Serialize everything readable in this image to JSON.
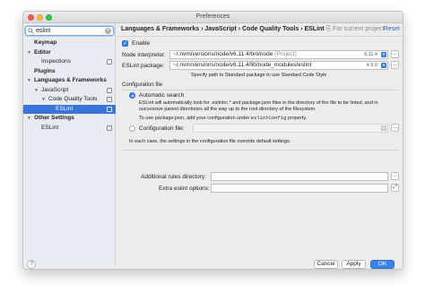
{
  "window": {
    "title": "Preferences"
  },
  "sidebar": {
    "search_value": "eslint",
    "items": [
      {
        "label": "Keymap"
      },
      {
        "label": "Editor"
      },
      {
        "label": "Inspections"
      },
      {
        "label": "Plugins"
      },
      {
        "label": "Languages & Frameworks"
      },
      {
        "label": "JavaScript"
      },
      {
        "label": "Code Quality Tools"
      },
      {
        "label": "ESLint"
      },
      {
        "label": "Other Settings"
      },
      {
        "label": "ESLint"
      }
    ]
  },
  "header": {
    "breadcrumb": "Languages & Frameworks › JavaScript › Code Quality Tools › ESLint",
    "scope_note": "⎘ For current project",
    "reset_label": "Reset"
  },
  "form": {
    "enable_label": "Enable",
    "node_interpreter_label": "Node interpreter:",
    "node_interpreter_value": "~/.nvm/versions/node/v6.11.4/bin/node",
    "node_interpreter_hint": "(Project)",
    "node_version": "6.11.4",
    "eslint_package_label": "ESLint package:",
    "eslint_package_value": "~/.nvm/versions/node/v6.11.4/lib/node_modules/eslint",
    "eslint_version": "4.9.0",
    "package_hint": "Specify path to Standard package to use Standard Code Style",
    "config_group_title": "Configuration file",
    "auto_search_label": "Automatic search",
    "auto_search_desc_1": "ESLint will automatically look for .eslintrc.* and package.json files in the directory of the file to be linted, and in",
    "auto_search_desc_2": "successive parent directories all the way up to the root directory of the filesystem.",
    "auto_search_desc_3_pre": "To use package.json, add your configuration under ",
    "auto_search_desc_3_code": "eslintConfig",
    "auto_search_desc_3_post": " property.",
    "config_file_label": "Configuration file:",
    "each_case_note": "In each case, the settings in the configuration file override default settings.",
    "rules_dir_label": "Additional rules directory:",
    "extra_options_label": "Extra eslint options:"
  },
  "footer": {
    "help_label": "?",
    "cancel_label": "Cancel",
    "apply_label": "Apply",
    "ok_label": "OK"
  },
  "colors": {
    "accent": "#3b82e8",
    "selection": "#3875d7",
    "link": "#2a62c9"
  }
}
